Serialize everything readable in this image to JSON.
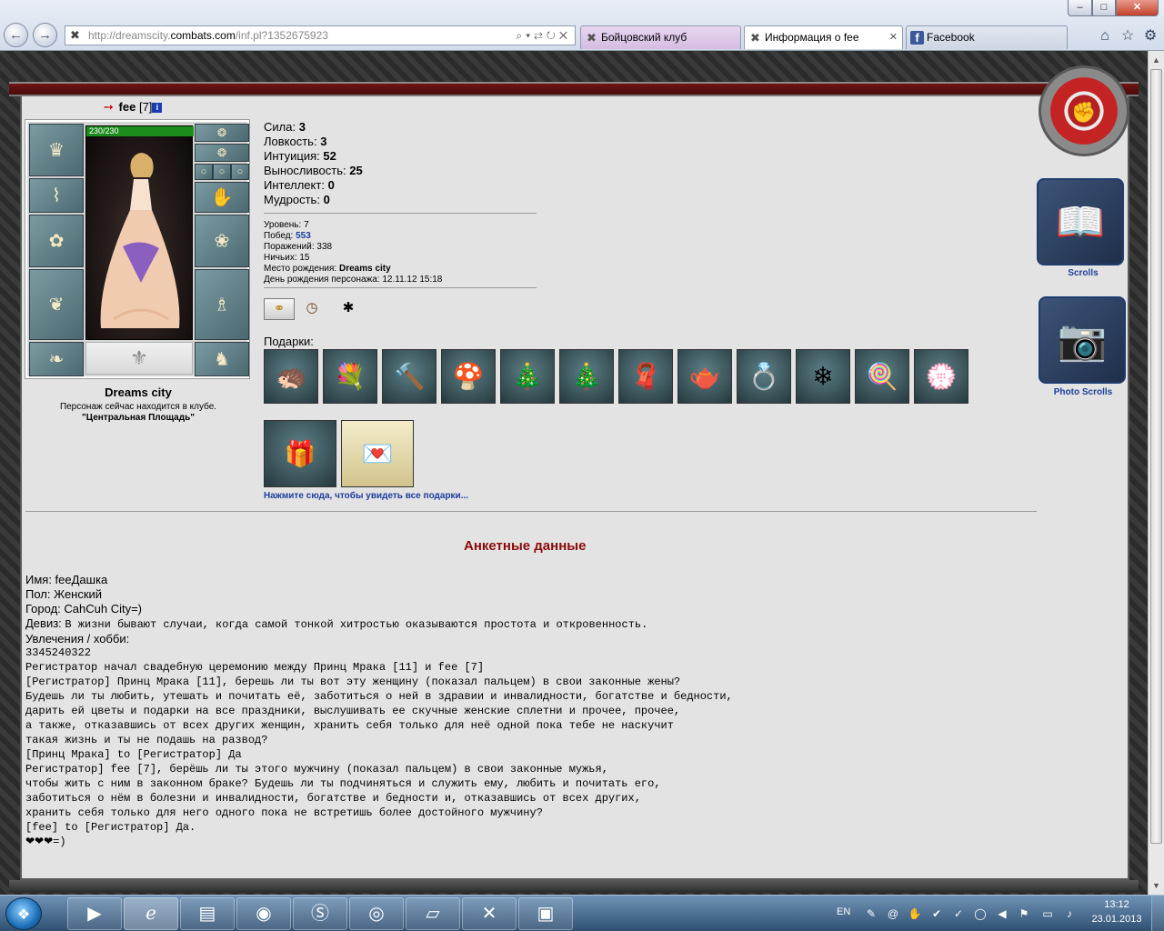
{
  "browser": {
    "url_prefix": "http://dreamscity.",
    "url_domain": "combats.com",
    "url_suffix": "/inf.pl?1352675923",
    "tabs": [
      {
        "label": "Бойцовский клуб"
      },
      {
        "label": "Информация о fee"
      },
      {
        "label": "Facebook"
      }
    ]
  },
  "character": {
    "name": "fee",
    "level": "[7]",
    "hp": "230/230",
    "city": "Dreams city",
    "location_text": "Персонаж сейчас находится в клубе.",
    "location_name": "\"Центральная Площадь\""
  },
  "stats": [
    {
      "label": "Сила:",
      "value": "3"
    },
    {
      "label": "Ловкость:",
      "value": "3"
    },
    {
      "label": "Интуиция:",
      "value": "52"
    },
    {
      "label": "Выносливость:",
      "value": "25"
    },
    {
      "label": "Интеллект:",
      "value": "0"
    },
    {
      "label": "Мудрость:",
      "value": "0"
    }
  ],
  "info": {
    "level_label": "Уровень:",
    "level_value": "7",
    "wins_label": "Побед:",
    "wins_value": "553",
    "losses_label": "Поражений:",
    "losses_value": "338",
    "draws_label": "Ничьих:",
    "draws_value": "15",
    "birthplace_label": "Место рождения:",
    "birthplace_value": "Dreams city",
    "birthday_label": "День рождения персонажа:",
    "birthday_value": "12.11.12 15:18"
  },
  "gifts": {
    "label": "Подарки:",
    "link": "Нажмите сюда, чтобы увидеть все подарки..."
  },
  "sidebar": {
    "scrolls": "Scrolls",
    "photos": "Photo Scrolls"
  },
  "anketa": {
    "title": "Анкетные данные",
    "name_line": "Имя: feeДашка",
    "sex_line": "Пол: Женский",
    "city_line": "Город: CahCuh City=)",
    "motto_label": "Девиз: ",
    "motto_value": "В жизни бывают случаи, когда самой тонкой хитростью оказываются простота и откровенность.",
    "hobby_line": "Увлечения / хобби:",
    "bio": "3345240322\nРегистратор начал свадебную церемонию между Принц Мрака [11] и fee [7]\n[Регистратор] Принц Мрака [11], берешь ли ты вот эту женщину (показал пальцем) в свои законные жены?\nБудешь ли ты любить, утешать и почитать её, заботиться о ней в здравии и инвалидности, богатстве и бедности,\nдарить ей цветы и подарки на все праздники, выслушивать ее скучные женские сплетни и прочее, прочее,\nа также, отказавшись от всех других женщин, хранить себя только для неё одной пока тебе не наскучит\nтакая жизнь и ты не подашь на развод?\n[Принц Мрака] to [Регистратор] Да\nРегистратор] fee [7], берёшь ли ты этого мужчину (показал пальцем) в свои законные мужья,\nчтобы жить с ним в законном браке? Будешь ли ты подчиняться и служить ему, любить и почитать его,\nзаботиться о нём в болезни и инвалидности, богатстве и бедности и, отказавшись от всех других,\nхранить себя только для него одного пока не встретишь более достойного мужчину?\n[fee] to [Регистратор] Да.\n❤❤❤=)"
  },
  "taskbar": {
    "lang": "EN",
    "time": "13:12",
    "date": "23.01.2013"
  }
}
